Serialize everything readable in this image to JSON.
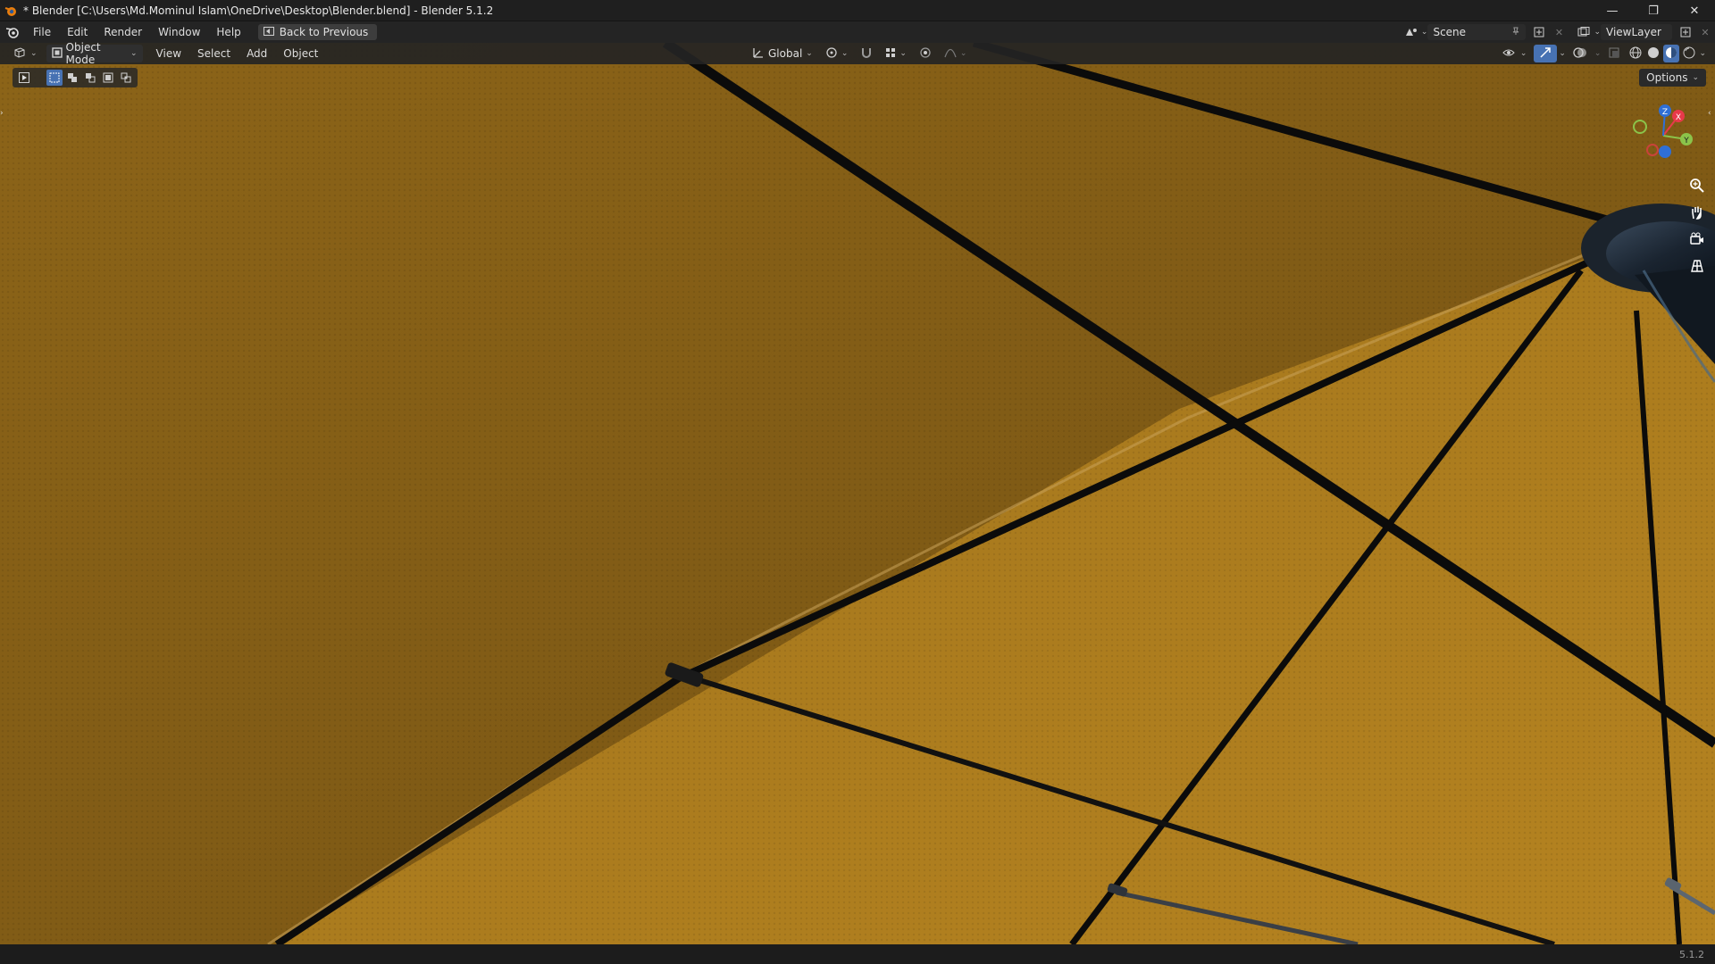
{
  "window": {
    "title": "* Blender [C:\\Users\\Md.Mominul Islam\\OneDrive\\Desktop\\Blender.blend] - Blender 5.1.2",
    "controls": [
      "minimize",
      "restore",
      "close"
    ]
  },
  "topbar": {
    "menus": [
      "File",
      "Edit",
      "Render",
      "Window",
      "Help"
    ],
    "back_button": "Back to Previous",
    "scene_name": "Scene",
    "view_layer": "ViewLayer"
  },
  "viewport_header": {
    "mode": "Object Mode",
    "menus": [
      "View",
      "Select",
      "Add",
      "Object"
    ],
    "transform_orientation": "Global"
  },
  "tool_settings": {
    "options_label": "Options"
  },
  "gizmo": {
    "axes": [
      "X",
      "Y",
      "Z"
    ],
    "colors": {
      "x": "#e8394a",
      "y": "#8bc34a",
      "z": "#2f6fd6"
    }
  },
  "status": {
    "version": "5.1.2"
  },
  "colors": {
    "canopy": "#8a6217",
    "rib": "#0b0b0b",
    "accent": "#4772b3"
  }
}
